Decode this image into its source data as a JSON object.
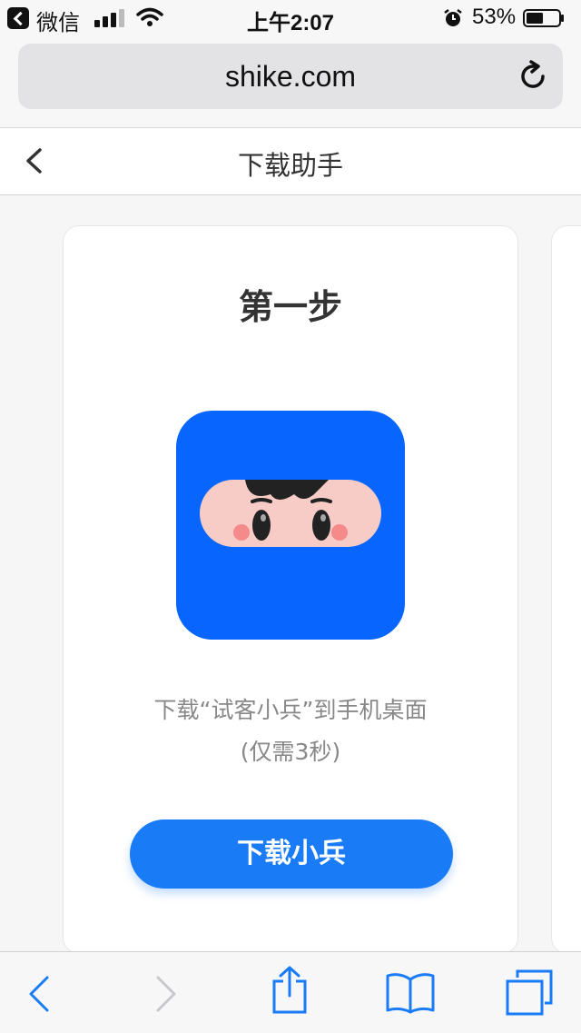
{
  "status_bar": {
    "app": "微信",
    "time": "上午2:07",
    "battery": "53%",
    "battery_level": 0.53
  },
  "browser": {
    "url": "shike.com"
  },
  "page": {
    "title": "下载助手"
  },
  "card": {
    "step_title": "第一步",
    "desc_line1": "下载“试客小兵”到手机桌面",
    "desc_line2": "(仅需3秒)",
    "button_label": "下载小兵"
  },
  "colors": {
    "accent": "#1a7bf7",
    "logo_bg": "#0866ff",
    "toolbar_icon": "#1a7bf7"
  }
}
